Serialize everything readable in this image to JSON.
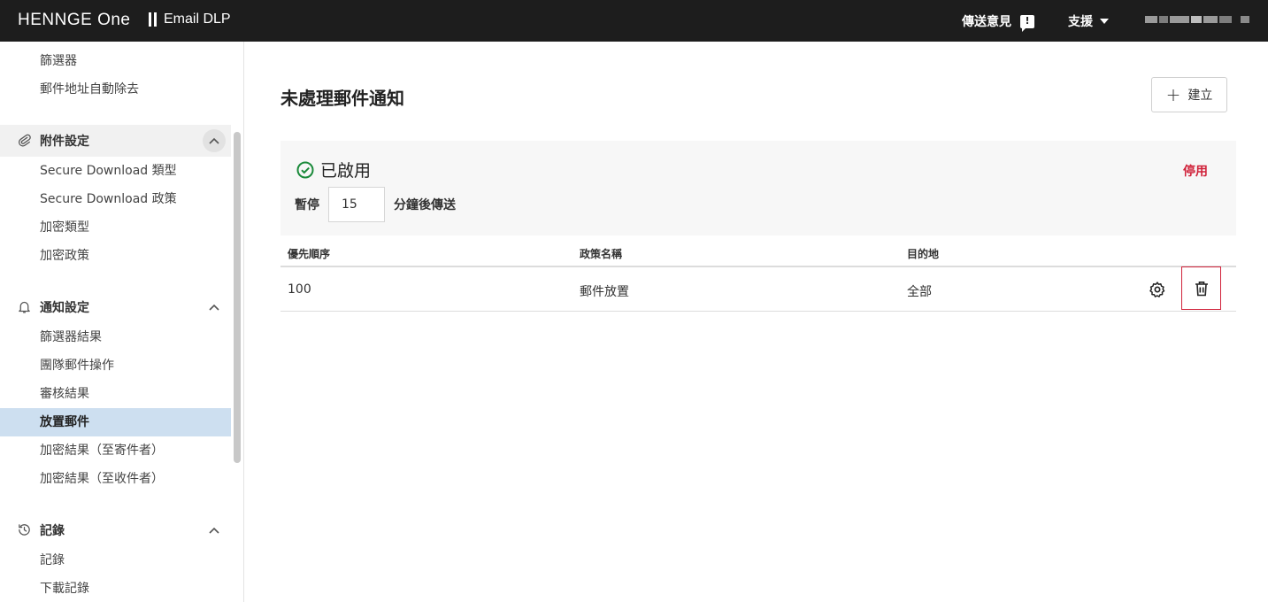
{
  "header": {
    "brand_main": "HENNGE ",
    "brand_one": "One",
    "product": "Email DLP",
    "feedback_label": "傳送意見",
    "feedback_icon": "!",
    "support_label": "支援"
  },
  "sidebar": {
    "items_top": [
      {
        "label": "篩選器"
      },
      {
        "label": "郵件地址自動除去"
      }
    ],
    "attachment_section": {
      "label": "附件設定",
      "items": [
        {
          "label": "Secure Download 類型"
        },
        {
          "label": "Secure Download 政策"
        },
        {
          "label": "加密類型"
        },
        {
          "label": "加密政策"
        }
      ]
    },
    "notification_section": {
      "label": "通知設定",
      "items": [
        {
          "label": "篩選器結果"
        },
        {
          "label": "團隊郵件操作"
        },
        {
          "label": "審核結果"
        },
        {
          "label": "放置郵件",
          "active": true
        },
        {
          "label": "加密結果（至寄件者）"
        },
        {
          "label": "加密結果（至收件者）"
        }
      ]
    },
    "log_section": {
      "label": "記錄",
      "items": [
        {
          "label": "記錄"
        },
        {
          "label": "下載記錄"
        }
      ]
    }
  },
  "main": {
    "title": "未處理郵件通知",
    "create_label": "建立",
    "status_label": "已啟用",
    "disable_label": "停用",
    "pause_prefix": "暫停",
    "pause_value": "15",
    "pause_suffix": "分鐘後傳送",
    "table": {
      "columns": [
        "優先順序",
        "政策名稱",
        "目的地"
      ],
      "rows": [
        {
          "priority": "100",
          "name": "郵件放置",
          "destination": "全部"
        }
      ]
    }
  },
  "colors": {
    "topbar": "#1d1d1d",
    "active_item": "#cddff0",
    "danger": "#d0223a",
    "success": "#1a8a3a"
  }
}
